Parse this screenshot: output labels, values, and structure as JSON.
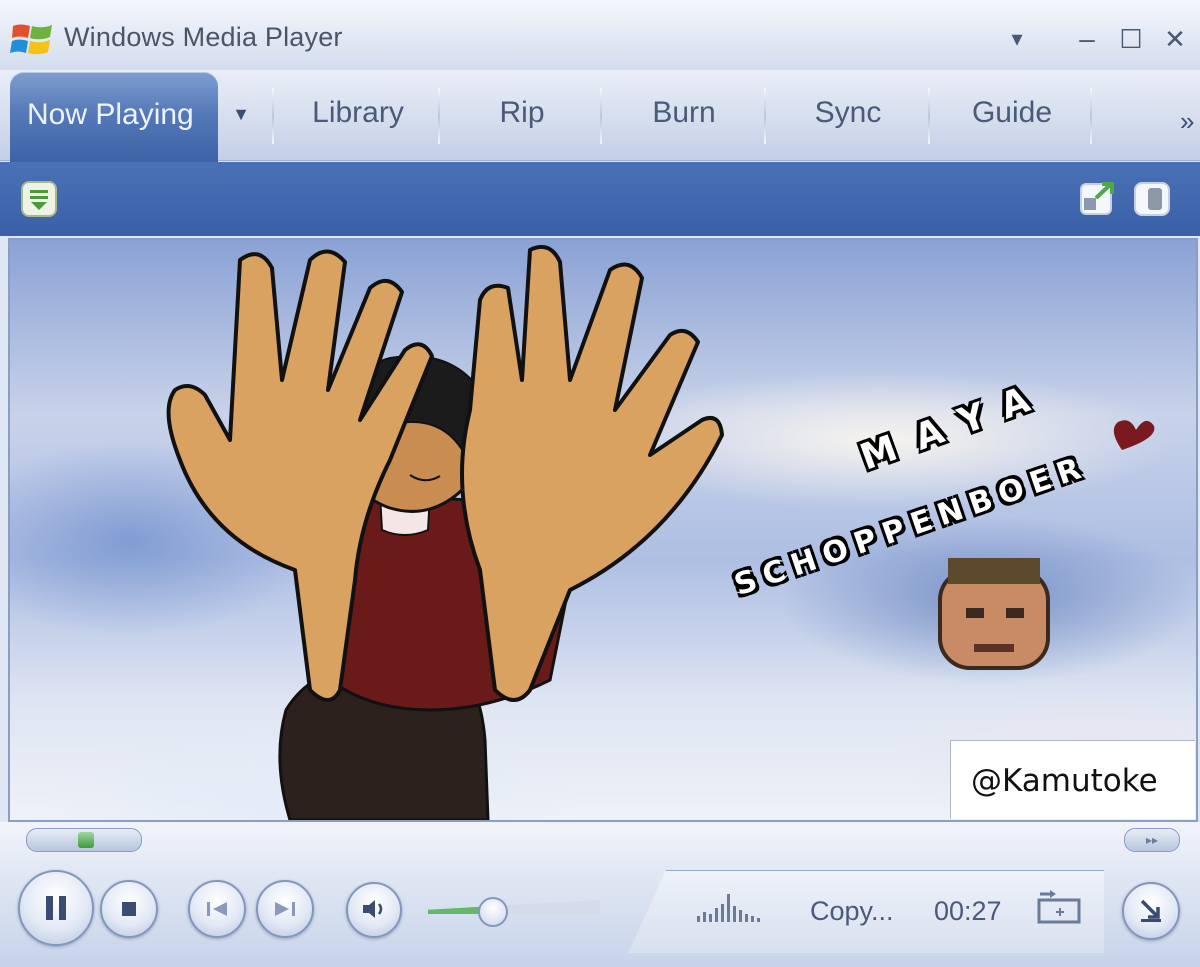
{
  "window": {
    "title": "Windows Media Player",
    "caption_buttons": {
      "dropdown": "▾",
      "minimize": "–",
      "maximize": "☐",
      "close": "✕"
    }
  },
  "tabs": {
    "active": "Now Playing",
    "items": [
      "Library",
      "Rip",
      "Burn",
      "Sync",
      "Guide"
    ],
    "more": "»"
  },
  "video": {
    "overlay_text_line1": "MAYA",
    "overlay_text_line2": "SCHOPPENBOER",
    "credit": "@Kamutoke"
  },
  "status": {
    "text": "Copy...",
    "time": "00:27"
  },
  "colors": {
    "accent": "#3c61a6",
    "header_bar": "#3a60a8",
    "seek_progress": "#3c9a3c"
  },
  "icons": [
    "windows-logo-icon",
    "now-playing-options-icon",
    "compact-mode-icon",
    "fullscreen-icon",
    "pause-icon",
    "stop-icon",
    "previous-icon",
    "next-icon",
    "mute-icon",
    "equalizer-icon",
    "repeat-icon",
    "switch-to-skin-icon"
  ]
}
